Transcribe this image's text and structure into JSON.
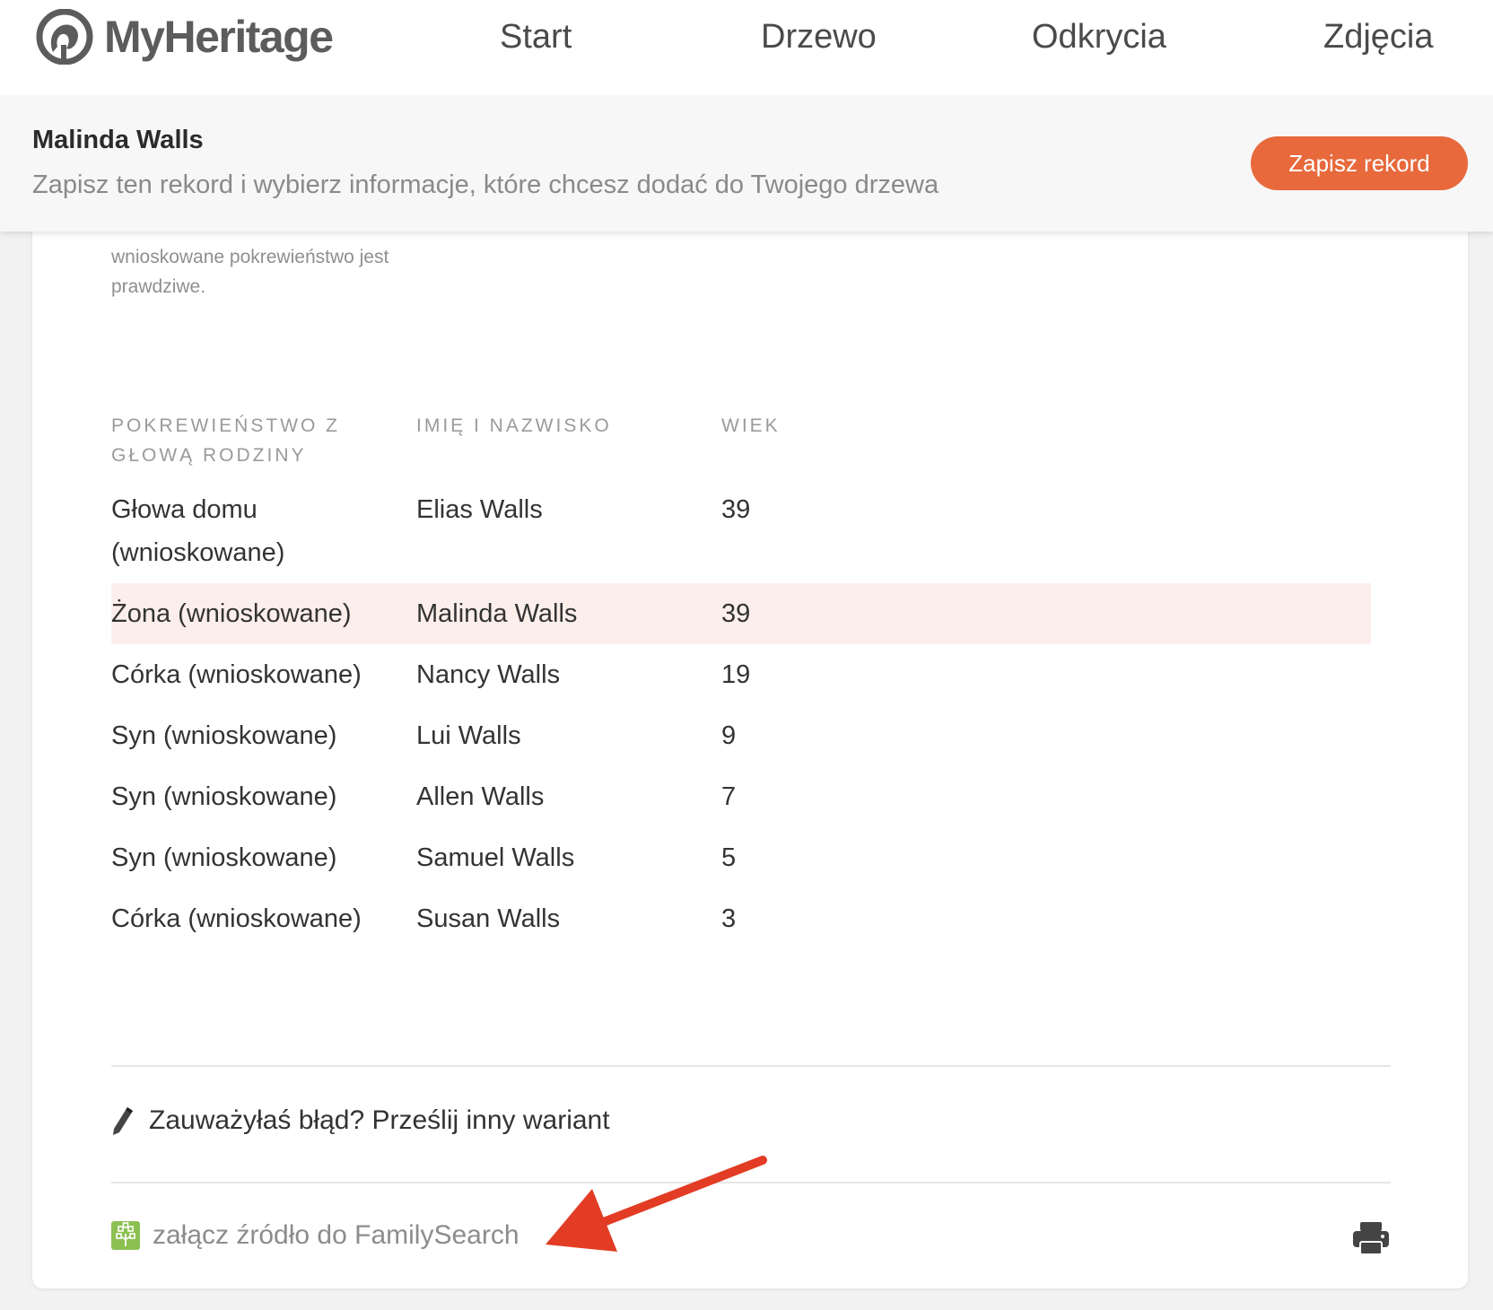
{
  "nav": {
    "logo": "MyHeritage",
    "items": [
      "Start",
      "Drzewo",
      "Odkrycia",
      "Zdjęcia"
    ]
  },
  "record_bar": {
    "title": "Malinda Walls",
    "subtitle": "Zapisz ten rekord i wybierz informacje, które chcesz dodać do Twojego drzewa",
    "save_label": "Zapisz rekord"
  },
  "notice": {
    "lines": [
      "wnioskowane pokrewieństwo jest",
      "prawdziwe."
    ]
  },
  "table": {
    "headers": {
      "relation_line1": "POKREWIEŃSTWO Z",
      "relation_line2": "GŁOWĄ RODZINY",
      "name": "IMIĘ I NAZWISKO",
      "age": "WIEK"
    },
    "rows": [
      {
        "relation": "Głowa domu (wnioskowane)",
        "name": "Elias Walls",
        "age": "39"
      },
      {
        "relation": "Żona (wnioskowane)",
        "name": "Malinda Walls",
        "age": "39"
      },
      {
        "relation": "Córka (wnioskowane)",
        "name": "Nancy Walls",
        "age": "19"
      },
      {
        "relation": "Syn (wnioskowane)",
        "name": "Lui Walls",
        "age": "9"
      },
      {
        "relation": "Syn (wnioskowane)",
        "name": "Allen Walls",
        "age": "7"
      },
      {
        "relation": "Syn (wnioskowane)",
        "name": "Samuel Walls",
        "age": "5"
      },
      {
        "relation": "Córka (wnioskowane)",
        "name": "Susan Walls",
        "age": "3"
      }
    ]
  },
  "footer": {
    "feedback": "Zauważyłaś błąd? Prześlij inny wariant",
    "familysearch": "załącz źródło do FamilySearch"
  },
  "colors": {
    "accent": "#e8693c",
    "highlight_row": "#fcefeb",
    "familysearch_green": "#8cc151",
    "annotation_arrow": "#e23c24"
  },
  "icons": [
    "myheritage-logo-icon",
    "pencil-icon",
    "familysearch-tree-icon",
    "printer-icon",
    "arrow-annotation"
  ]
}
